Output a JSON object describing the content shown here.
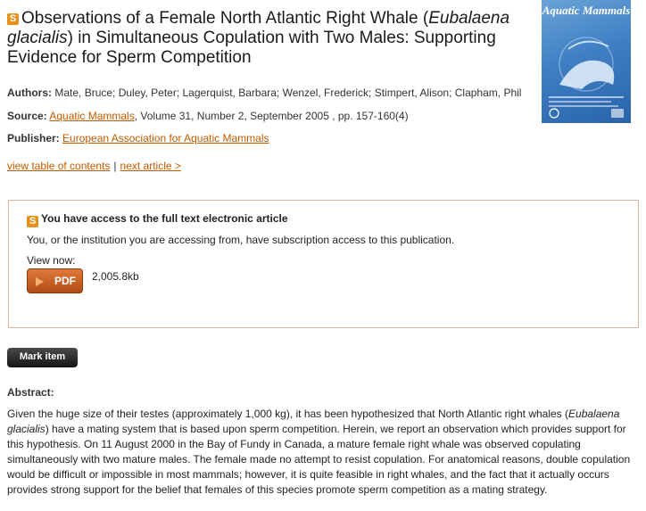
{
  "article": {
    "badge": "S",
    "title_part1": "Observations of a Female North Atlantic Right Whale (",
    "title_italic": "Eubalaena glacialis",
    "title_part2": ") in Simultaneous Copulation with Two Males: Supporting Evidence for Sperm Competition"
  },
  "cover": {
    "title": "Aquatic Mammals",
    "colors": {
      "background": "#3f7fc4"
    }
  },
  "meta": {
    "authors_label": "Authors:",
    "authors": "Mate, Bruce; Duley, Peter; Lagerquist, Barbara; Wenzel, Frederick; Stimpert, Alison; Clapham, Phil",
    "source_label": "Source:",
    "source_link": "Aquatic Mammals",
    "source_rest": ", Volume 31, Number 2, September 2005 , pp. 157-160(4)",
    "publisher_label": "Publisher:",
    "publisher_link": "European Association for Aquatic Mammals"
  },
  "nav": {
    "toc": "view table of contents",
    "separator": "|",
    "next": "next article >"
  },
  "access": {
    "badge": "S",
    "heading": "You have access to the full text electronic article",
    "text": "You, or the institution you are accessing from, have subscription access to this publication.",
    "view_now": "View now:",
    "pdf_label": "PDF",
    "pdf_size": "2,005.8kb",
    "colors": {
      "border": "#d9b59a",
      "button": "#c25b00"
    }
  },
  "mark_item": "Mark item",
  "abstract": {
    "heading": "Abstract:",
    "part1": "Given the huge size of their testes (approximately 1,000 kg), it has been hypothesized that North Atlantic right whales (",
    "italic1": "Eubalaena glacialis",
    "part2": ") have a mating system that is based upon sperm competition. Herein, we report an observation which provides support for this hypothesis. On 11 August 2000 in the Bay of Fundy in Canada, a mature female right whale was observed copulating simultaneously with two mature males. The female made no attempt to resist copulation. For anatomical reasons, double copulation would be difficult or impossible in most mammals; however, it is quite feasible in right whales, and the fact that it actually occurs provides strong support for the belief that females of this species promote sperm competition as a mating strategy."
  },
  "colors": {
    "link": "#c25b00",
    "text": "#222222"
  }
}
